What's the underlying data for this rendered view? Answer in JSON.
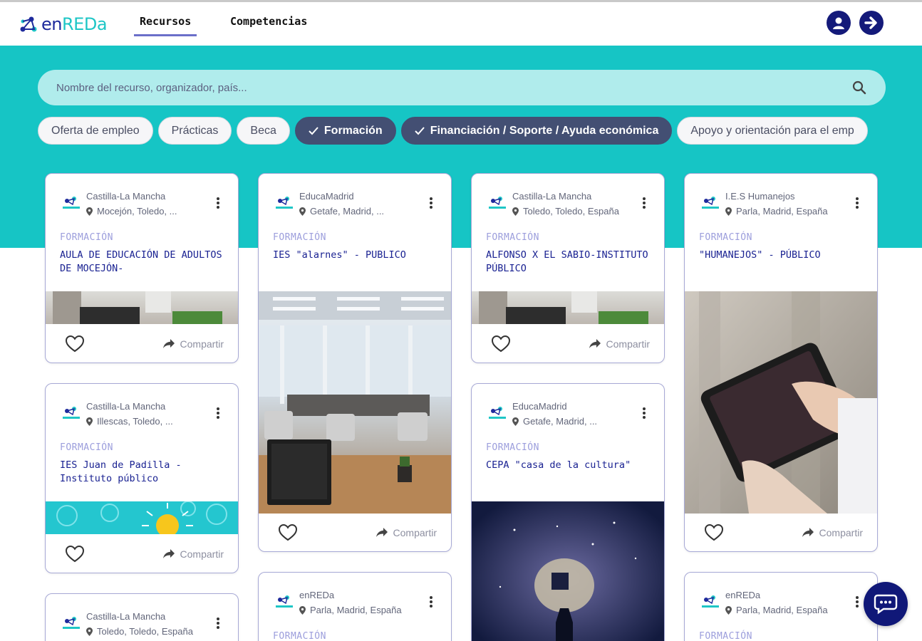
{
  "header": {
    "brand_prefix": "en",
    "brand_highlight": "RED",
    "brand_suffix": "a",
    "nav": [
      {
        "label": "Recursos",
        "active": true
      },
      {
        "label": "Competencias",
        "active": false
      }
    ],
    "icons": {
      "profile": "user-circle-icon",
      "login": "arrow-right-circle-icon"
    }
  },
  "search": {
    "placeholder": "Nombre del recurso, organizador, país..."
  },
  "filters": [
    {
      "label": "Oferta de empleo",
      "selected": false
    },
    {
      "label": "Prácticas",
      "selected": false
    },
    {
      "label": "Beca",
      "selected": false
    },
    {
      "label": "Formación",
      "selected": true
    },
    {
      "label": "Financiación / Soporte / Ayuda económica",
      "selected": true
    },
    {
      "label": "Apoyo y orientación para el emp",
      "selected": false
    }
  ],
  "share_label": "Compartir",
  "cards": [
    {
      "org": "Castilla-La Mancha",
      "location": "Mocejón, Toledo, ...",
      "type": "FORMACIÓN",
      "title": "AULA DE EDUCACIÓN DE ADULTOS DE MOCEJÓN-",
      "image": "office-strip"
    },
    {
      "org": "EducaMadrid",
      "location": "Getafe, Madrid, ...",
      "type": "FORMACIÓN",
      "title": "IES \"alarnes\" - PUBLICO",
      "image": "office-room"
    },
    {
      "org": "Castilla-La Mancha",
      "location": "Toledo, Toledo, España",
      "type": "FORMACIÓN",
      "title": "ALFONSO X EL SABIO-INSTITUTO PÚBLICO",
      "image": "office-strip"
    },
    {
      "org": "I.E.S Humanejos",
      "location": "Parla, Madrid, España",
      "type": "FORMACIÓN",
      "title": "\"HUMANEJOS\" - PÚBLICO",
      "image": "tablet"
    },
    {
      "org": "Castilla-La Mancha",
      "location": "Illescas, Toledo, ...",
      "type": "FORMACIÓN",
      "title": "IES Juan de Padilla - Instituto público",
      "image": "bulbs"
    },
    {
      "org": "EducaMadrid",
      "location": "Getafe, Madrid, ...",
      "type": "FORMACIÓN",
      "title": "CEPA \"casa de la cultura\"",
      "image": "brain"
    },
    {
      "org": "Castilla-La Mancha",
      "location": "Toledo, Toledo, España",
      "type": "",
      "title": "",
      "image": ""
    },
    {
      "org": "enREDa",
      "location": "Parla, Madrid, España",
      "type": "FORMACIÓN",
      "title": "",
      "image": ""
    },
    {
      "org": "enREDa",
      "location": "Parla, Madrid, España",
      "type": "FORMACIÓN",
      "title": "",
      "image": ""
    }
  ],
  "colors": {
    "accent": "#16c5c5",
    "navy": "#141a7a",
    "chip_selected": "#434f73",
    "card_border": "#a7a9d6"
  },
  "chat": {
    "icon": "chat-bubble-icon"
  }
}
